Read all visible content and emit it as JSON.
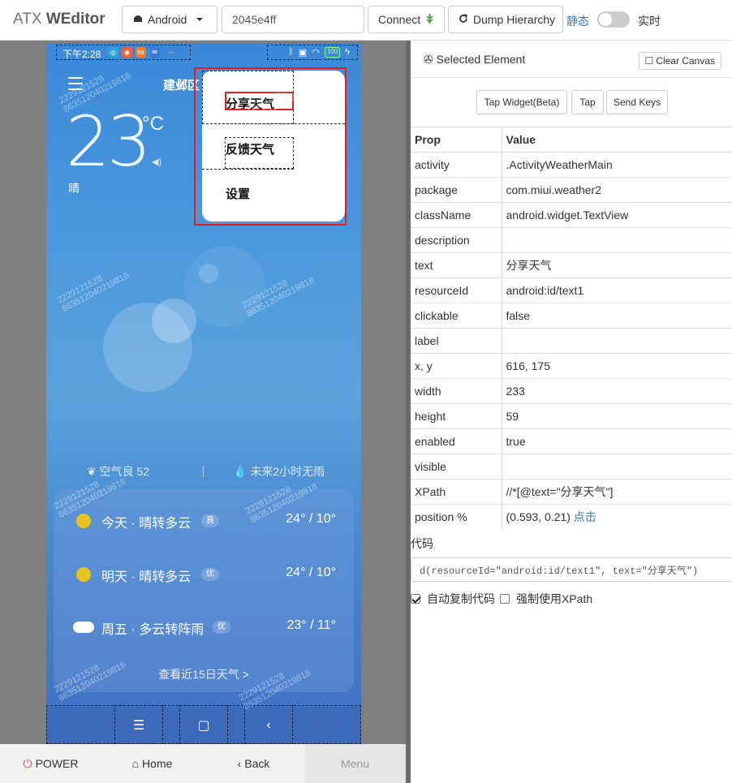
{
  "app": {
    "brand_light": "ATX",
    "brand_bold": "WEditor"
  },
  "toolbar": {
    "platform": "Android",
    "serial": "2045e4ff",
    "connect": "Connect",
    "dump": "Dump Hierarchy",
    "static_label": "静态",
    "live_label": "实时"
  },
  "device": {
    "status_time": "下午2:28",
    "city": "建邺区",
    "temperature": "23",
    "temp_unit": "°C",
    "condition": "晴",
    "menu": [
      "分享天气",
      "反馈天气",
      "设置"
    ],
    "air": "空气良 52",
    "rain": "未来2小时无雨",
    "forecast": [
      {
        "label": "今天 · 晴转多云",
        "badge": "良",
        "range": "24° / 10°",
        "icon": "sun-icon"
      },
      {
        "label": "明天 · 晴转多云",
        "badge": "优",
        "range": "24° / 10°",
        "icon": "sun-icon"
      },
      {
        "label": "周五 · 多云转阵雨",
        "badge": "优",
        "range": "23° / 11°",
        "icon": "cloud-icon"
      }
    ],
    "more_15": "查看近15日天气  >",
    "watermark_line1": "2229121528",
    "watermark_line2": "863512040219818"
  },
  "bottombar": {
    "power": "POWER",
    "home": "Home",
    "back": "Back",
    "menu": "Menu"
  },
  "inspector": {
    "title": "Selected Element",
    "clear_canvas": "Clear Canvas",
    "tap_widget": "Tap Widget(Beta)",
    "tap": "Tap",
    "send_keys": "Send Keys",
    "col_prop": "Prop",
    "col_value": "Value",
    "rows": [
      {
        "key": "activity",
        "value": ".ActivityWeatherMain"
      },
      {
        "key": "package",
        "value": "com.miui.weather2"
      },
      {
        "key": "className",
        "value": "android.widget.TextView"
      },
      {
        "key": "description",
        "value": ""
      },
      {
        "key": "text",
        "value": "分享天气"
      },
      {
        "key": "resourceId",
        "value": "android:id/text1"
      },
      {
        "key": "clickable",
        "value": "false"
      },
      {
        "key": "label",
        "value": ""
      },
      {
        "key": "x, y",
        "value": "616, 175"
      },
      {
        "key": "width",
        "value": "233"
      },
      {
        "key": "height",
        "value": "59"
      },
      {
        "key": "enabled",
        "value": "true"
      },
      {
        "key": "visible",
        "value": ""
      },
      {
        "key": "XPath",
        "value": "//*[@text=\"分享天气\"]"
      },
      {
        "key": "position %",
        "value": "(0.593, 0.21)"
      }
    ],
    "position_link": "点击",
    "code_label": "代码",
    "code": "d(resourceId=\"android:id/text1\", text=\"分享天气\")",
    "auto_copy": "自动复制代码",
    "force_xpath": "强制使用XPath"
  },
  "colors": {
    "accent": "#337ab7",
    "selection": "#e02020",
    "power": "#d9534f"
  }
}
